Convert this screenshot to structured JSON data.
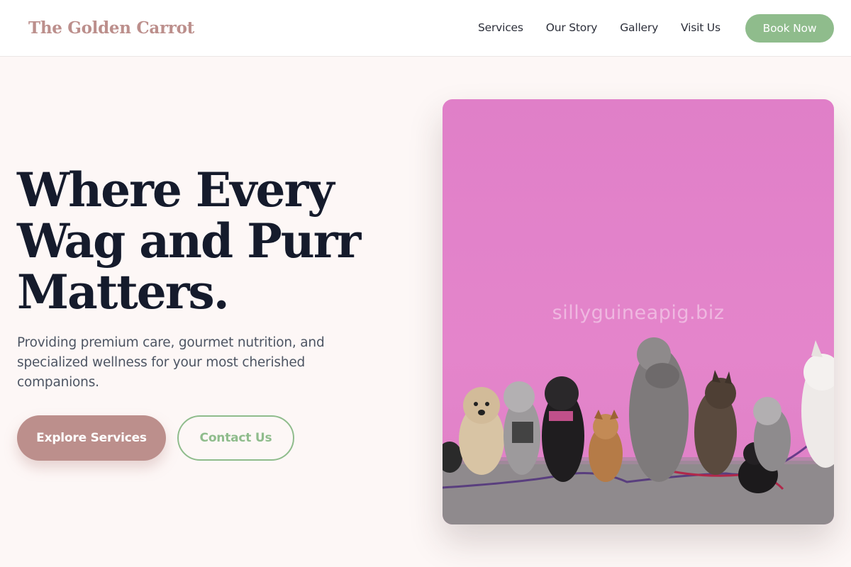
{
  "brand": {
    "name": "The Golden Carrot"
  },
  "nav": {
    "links": [
      "Services",
      "Our Story",
      "Gallery",
      "Visit Us"
    ],
    "cta": "Book Now"
  },
  "hero": {
    "headline_lines": [
      "Where Every",
      "Wag and Purr",
      "Matters."
    ],
    "subtext": "Providing premium care, gourmet nutrition, and specialized wellness for your most cherished companions.",
    "primary_button": "Explore Services",
    "secondary_button": "Contact Us",
    "image": {
      "subject": "dogs-sitting-in-row-against-pink-wall",
      "watermark": "sillyguineapig.biz"
    }
  },
  "colors": {
    "accent_rose": "#bc8f8c",
    "accent_sage": "#8fbc8c",
    "headline": "#151b2c",
    "background": "#fdf7f6",
    "wall_pink": "#e07fc8"
  }
}
